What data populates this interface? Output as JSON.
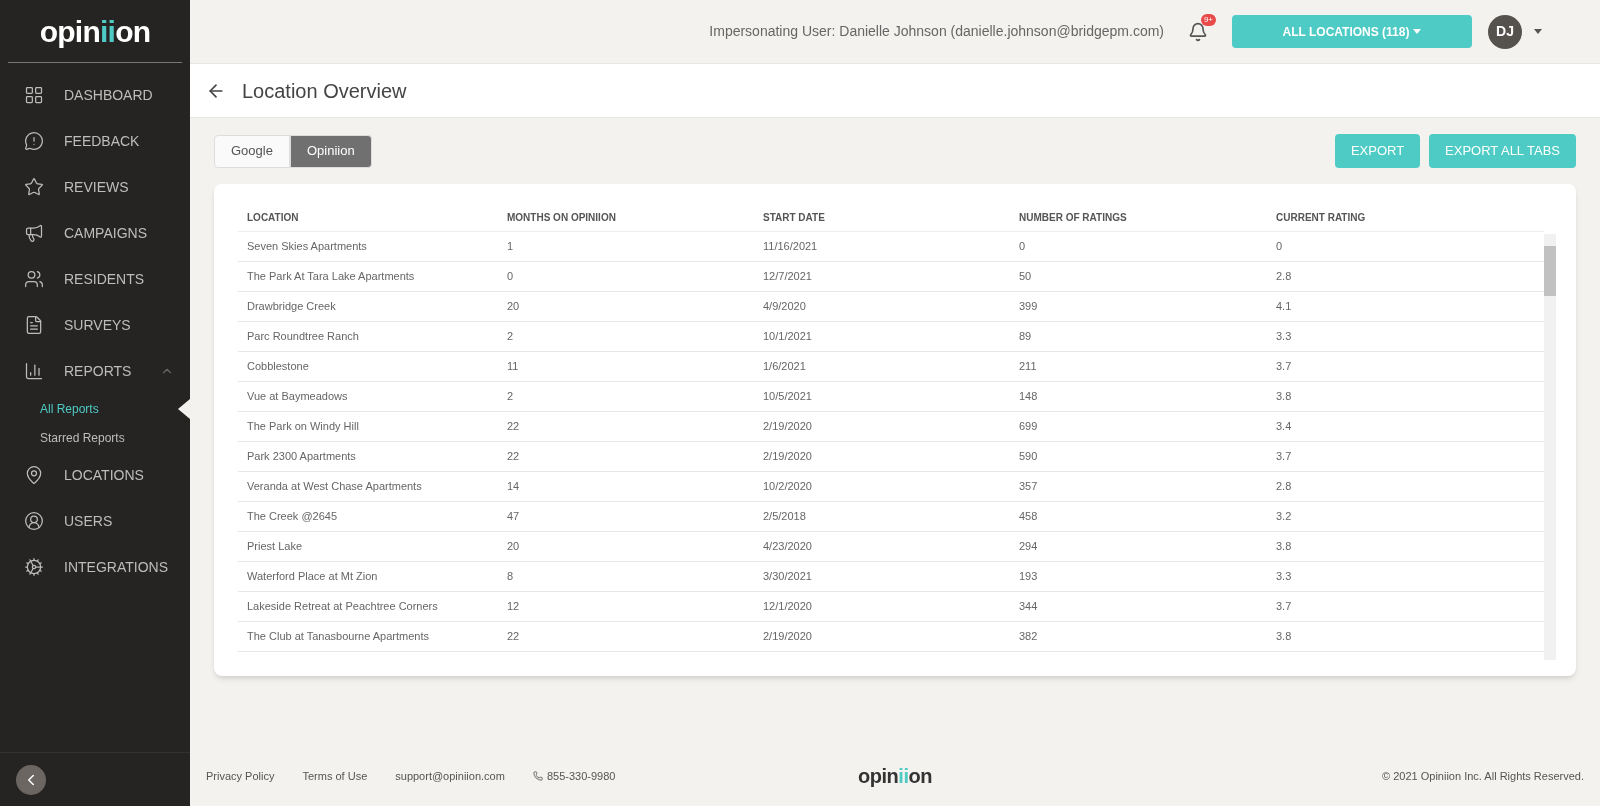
{
  "sidebar": {
    "logo": [
      "opin",
      "ii",
      "on"
    ],
    "items": [
      {
        "label": "DASHBOARD"
      },
      {
        "label": "FEEDBACK"
      },
      {
        "label": "REVIEWS"
      },
      {
        "label": "CAMPAIGNS"
      },
      {
        "label": "RESIDENTS"
      },
      {
        "label": "SURVEYS"
      },
      {
        "label": "REPORTS",
        "expanded": true,
        "children": [
          {
            "label": "All Reports",
            "selected": true
          },
          {
            "label": "Starred Reports",
            "selected": false
          }
        ]
      },
      {
        "label": "LOCATIONS"
      },
      {
        "label": "USERS"
      },
      {
        "label": "INTEGRATIONS"
      }
    ]
  },
  "header": {
    "impersonating": "Impersonating User: Danielle Johnson (danielle.johnson@bridgepm.com)",
    "notification_badge": "9+",
    "locations_button": "ALL LOCATIONS (118)",
    "avatar": "DJ"
  },
  "page_title": "Location Overview",
  "tabs": [
    {
      "label": "Google",
      "selected": false
    },
    {
      "label": "Opiniion",
      "selected": true
    }
  ],
  "buttons": [
    "EXPORT",
    "EXPORT ALL TABS"
  ],
  "table": {
    "columns": [
      "LOCATION",
      "MONTHS ON OPINIION",
      "START DATE",
      "NUMBER OF RATINGS",
      "CURRENT RATING"
    ],
    "rows": [
      [
        "Seven Skies Apartments",
        "1",
        "11/16/2021",
        "0",
        "0"
      ],
      [
        "The Park At Tara Lake Apartments",
        "0",
        "12/7/2021",
        "50",
        "2.8"
      ],
      [
        "Drawbridge Creek",
        "20",
        "4/9/2020",
        "399",
        "4.1"
      ],
      [
        "Parc Roundtree Ranch",
        "2",
        "10/1/2021",
        "89",
        "3.3"
      ],
      [
        "Cobblestone",
        "11",
        "1/6/2021",
        "211",
        "3.7"
      ],
      [
        "Vue at Baymeadows",
        "2",
        "10/5/2021",
        "148",
        "3.8"
      ],
      [
        "The Park on Windy Hill",
        "22",
        "2/19/2020",
        "699",
        "3.4"
      ],
      [
        "Park 2300 Apartments",
        "22",
        "2/19/2020",
        "590",
        "3.7"
      ],
      [
        "Veranda at West Chase Apartments",
        "14",
        "10/2/2020",
        "357",
        "2.8"
      ],
      [
        "The Creek @2645",
        "47",
        "2/5/2018",
        "458",
        "3.2"
      ],
      [
        "Priest Lake",
        "20",
        "4/23/2020",
        "294",
        "3.8"
      ],
      [
        "Waterford Place at Mt Zion",
        "8",
        "3/30/2021",
        "193",
        "3.3"
      ],
      [
        "Lakeside Retreat at Peachtree Corners",
        "12",
        "12/1/2020",
        "344",
        "3.7"
      ],
      [
        "The Club at Tanasbourne Apartments",
        "22",
        "2/19/2020",
        "382",
        "3.8"
      ]
    ]
  },
  "footer": {
    "links": [
      "Privacy Policy",
      "Terms of Use",
      "support@opiniion.com"
    ],
    "phone": "855-330-9980",
    "logo": [
      "opin",
      "ii",
      "on"
    ],
    "copyright": "© 2021 Opiniion Inc. All Rights Reserved."
  }
}
